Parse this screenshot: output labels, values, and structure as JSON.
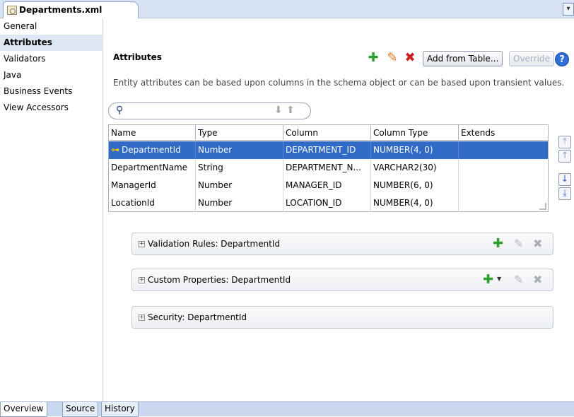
{
  "editor_tab": {
    "title": "Departments.xml",
    "icon": "xml-file-icon"
  },
  "nav": {
    "items": [
      {
        "label": "General",
        "active": false
      },
      {
        "label": "Attributes",
        "active": true
      },
      {
        "label": "Validators",
        "active": false
      },
      {
        "label": "Java",
        "active": false
      },
      {
        "label": "Business Events",
        "active": false
      },
      {
        "label": "View Accessors",
        "active": false
      }
    ]
  },
  "attributes": {
    "title": "Attributes",
    "description": "Entity attributes can be based upon columns in the schema object or can be based upon transient values.",
    "toolbar": {
      "add_icon": "plus-icon",
      "edit_icon": "pencil-icon",
      "delete_icon": "delete-icon",
      "add_from_table_label": "Add from Table...",
      "override_label": "Override",
      "help_icon": "help-icon"
    },
    "table": {
      "columns": [
        "Name",
        "Type",
        "Column",
        "Column Type",
        "Extends"
      ],
      "rows": [
        {
          "name": "DepartmentId",
          "type": "Number",
          "column": "DEPARTMENT_ID",
          "column_type": "NUMBER(4, 0)",
          "extends": "",
          "selected": true,
          "key": true
        },
        {
          "name": "DepartmentName",
          "type": "String",
          "column": "DEPARTMENT_N...",
          "column_type": "VARCHAR2(30)",
          "extends": "",
          "selected": false,
          "key": false
        },
        {
          "name": "ManagerId",
          "type": "Number",
          "column": "MANAGER_ID",
          "column_type": "NUMBER(6, 0)",
          "extends": "",
          "selected": false,
          "key": false
        },
        {
          "name": "LocationId",
          "type": "Number",
          "column": "LOCATION_ID",
          "column_type": "NUMBER(4, 0)",
          "extends": "",
          "selected": false,
          "key": false
        }
      ]
    }
  },
  "panels": [
    {
      "title": "Validation Rules: DepartmentId"
    },
    {
      "title": "Custom Properties: DepartmentId"
    },
    {
      "title": "Security: DepartmentId"
    }
  ],
  "bottom_tabs": [
    {
      "label": "Overview",
      "active": true
    },
    {
      "label": "Source",
      "active": false
    },
    {
      "label": "History",
      "active": false
    }
  ],
  "colors": {
    "selection": "#316ac5",
    "tab_strip": "#d7e3f2",
    "add_green": "#2da12d",
    "delete_red": "#cc1c1c"
  }
}
